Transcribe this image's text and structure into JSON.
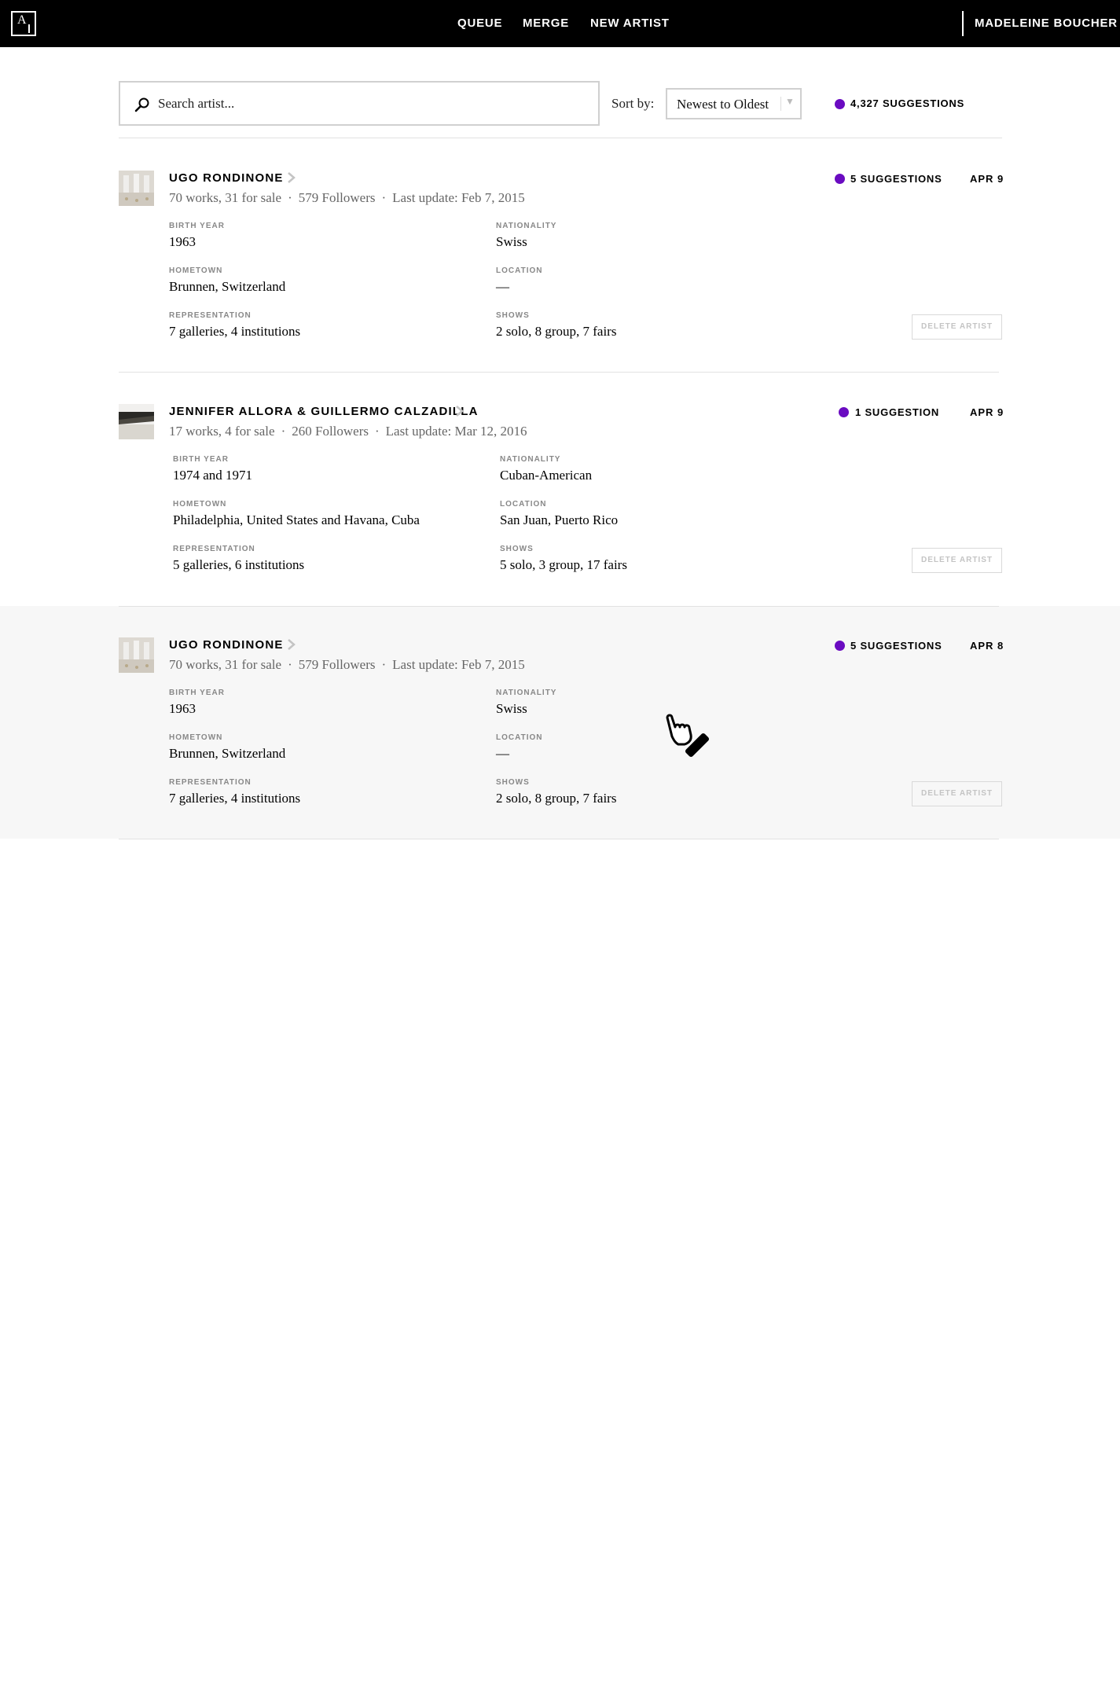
{
  "nav": {
    "logo_letter": "A",
    "items": [
      "QUEUE",
      "MERGE",
      "NEW ARTIST"
    ],
    "user": "MADELEINE BOUCHER"
  },
  "search": {
    "placeholder": "Search artist..."
  },
  "sort": {
    "label": "Sort by:",
    "value": "Newest to Oldest",
    "caret": "▼"
  },
  "total_suggestions": "4,327 SUGGESTIONS",
  "colors": {
    "accent": "#6a0bc1",
    "nav_bg": "#000000",
    "highlight_bg": "#f7f7f7"
  },
  "field_labels": {
    "birth_year": "BIRTH YEAR",
    "nationality": "NATIONALITY",
    "hometown": "HOMETOWN",
    "location": "LOCATION",
    "representation": "REPRESENTATION",
    "shows": "SHOWS"
  },
  "delete_label": "DELETE ARTIST",
  "artists": [
    {
      "name": "UGO RONDINONE",
      "works": "70 works, 31 for sale",
      "followers": "579 Followers",
      "last_update": "Last update: Feb 7, 2015",
      "birth_year": "1963",
      "nationality": "Swiss",
      "hometown": "Brunnen, Switzerland",
      "location": "—",
      "representation": "7 galleries, 4 institutions",
      "shows": "2 solo, 8 group, 7 fairs",
      "suggestions": "5 SUGGESTIONS",
      "date": "APR 9"
    },
    {
      "name": "JENNIFER ALLORA & GUILLERMO CALZADILLA",
      "works": "17 works, 4 for sale",
      "followers": "260 Followers",
      "last_update": "Last update: Mar 12, 2016",
      "birth_year": "1974 and 1971",
      "nationality": "Cuban-American",
      "hometown": "Philadelphia, United States and Havana, Cuba",
      "location": "San Juan, Puerto Rico",
      "representation": "5 galleries, 6 institutions",
      "shows": "5 solo, 3 group, 17 fairs",
      "suggestions": "1 SUGGESTION",
      "date": "APR 9"
    },
    {
      "name": "UGO RONDINONE",
      "works": "70 works, 31 for sale",
      "followers": "579 Followers",
      "last_update": "Last update: Feb 7, 2015",
      "birth_year": "1963",
      "nationality": "Swiss",
      "hometown": "Brunnen, Switzerland",
      "location": "—",
      "representation": "7 galleries, 4 institutions",
      "shows": "2 solo, 8 group, 7 fairs",
      "suggestions": "5 SUGGESTIONS",
      "date": "APR 8"
    }
  ]
}
